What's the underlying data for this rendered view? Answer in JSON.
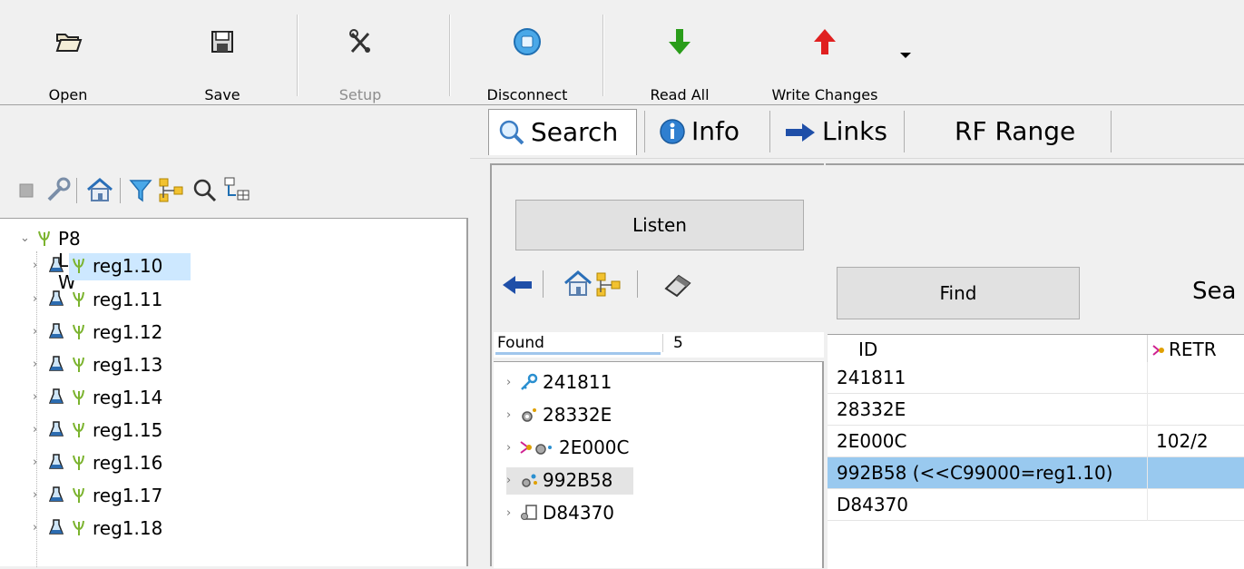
{
  "toolbar": {
    "open": "Open",
    "save": "Save",
    "setup": "Setup",
    "disconnect": "Disconnect",
    "read_all": "Read All",
    "write_changes": "Write Changes"
  },
  "tree": {
    "root": "P8 LR W",
    "items": [
      {
        "label": "reg1.10",
        "selected": true
      },
      {
        "label": "reg1.11"
      },
      {
        "label": "reg1.12"
      },
      {
        "label": "reg1.13"
      },
      {
        "label": "reg1.14"
      },
      {
        "label": "reg1.15"
      },
      {
        "label": "reg1.16"
      },
      {
        "label": "reg1.17"
      },
      {
        "label": "reg1.18"
      }
    ]
  },
  "tabs": [
    "Search",
    "Info",
    "Links",
    "RF Range"
  ],
  "search": {
    "listen_label": "Listen",
    "found_label": "Found",
    "found_count": "5",
    "found_items": [
      {
        "id": "241811",
        "icon": "key-icon"
      },
      {
        "id": "28332E",
        "icon": "gear-device-icon"
      },
      {
        "id": "2E000C",
        "icon": "network-device-icon"
      },
      {
        "id": "992B58",
        "icon": "multi-device-icon",
        "selected": true
      },
      {
        "id": "D84370",
        "icon": "device-icon"
      }
    ]
  },
  "results": {
    "find_label": "Find",
    "sea_label": "Sea",
    "col_id": "ID",
    "col_retr": "RETR",
    "rows": [
      {
        "id": "241811",
        "retr": ""
      },
      {
        "id": "28332E",
        "retr": ""
      },
      {
        "id": "2E000C",
        "retr": "102/2"
      },
      {
        "id": "992B58 (<<C99000=reg1.10)",
        "retr": "",
        "selected": true
      },
      {
        "id": "D84370",
        "retr": ""
      }
    ]
  },
  "colors": {
    "selection": "#cde8ff",
    "table_selection": "#99c9ef",
    "arrow_down": "#2a9d1a",
    "arrow_up": "#e02020"
  }
}
